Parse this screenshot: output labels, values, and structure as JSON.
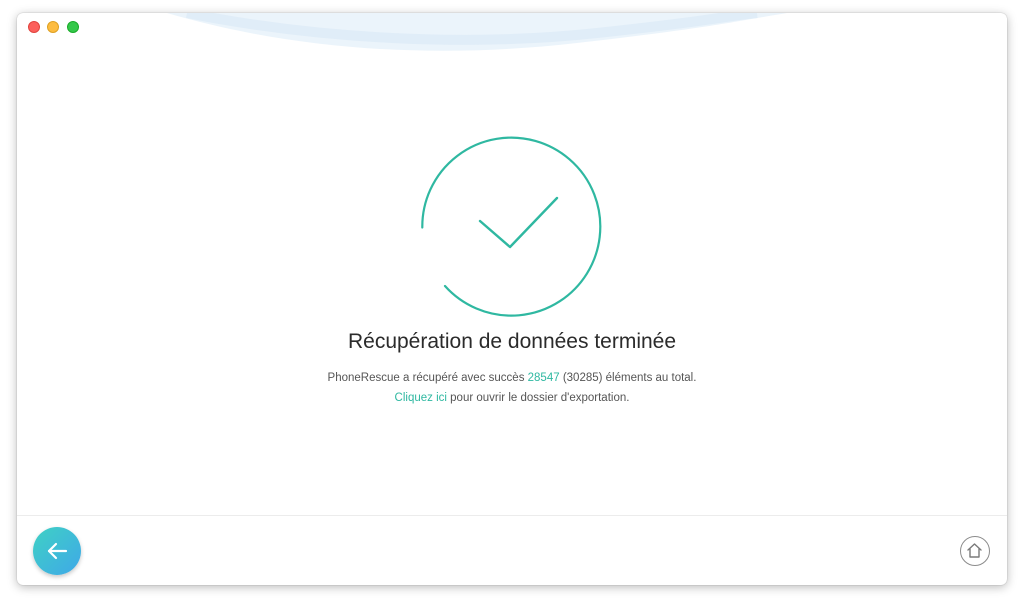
{
  "window": {
    "controls": [
      "close",
      "minimize",
      "maximize"
    ]
  },
  "main": {
    "status_icon": "success-check-icon",
    "title": "Récupération de données terminée",
    "summary": {
      "before": "PhoneRescue a récupéré avec succès ",
      "count": "28547",
      "after": " (30285) éléments au total."
    },
    "export": {
      "link": "Cliquez ici",
      "after": " pour ouvrir le dossier d'exportation."
    }
  },
  "footer": {
    "back_icon": "arrow-left-icon",
    "home_icon": "home-icon"
  },
  "colors": {
    "accent": "#2fb8a1",
    "back_button_start": "#3fd1c4",
    "back_button_end": "#3fa8e8"
  }
}
